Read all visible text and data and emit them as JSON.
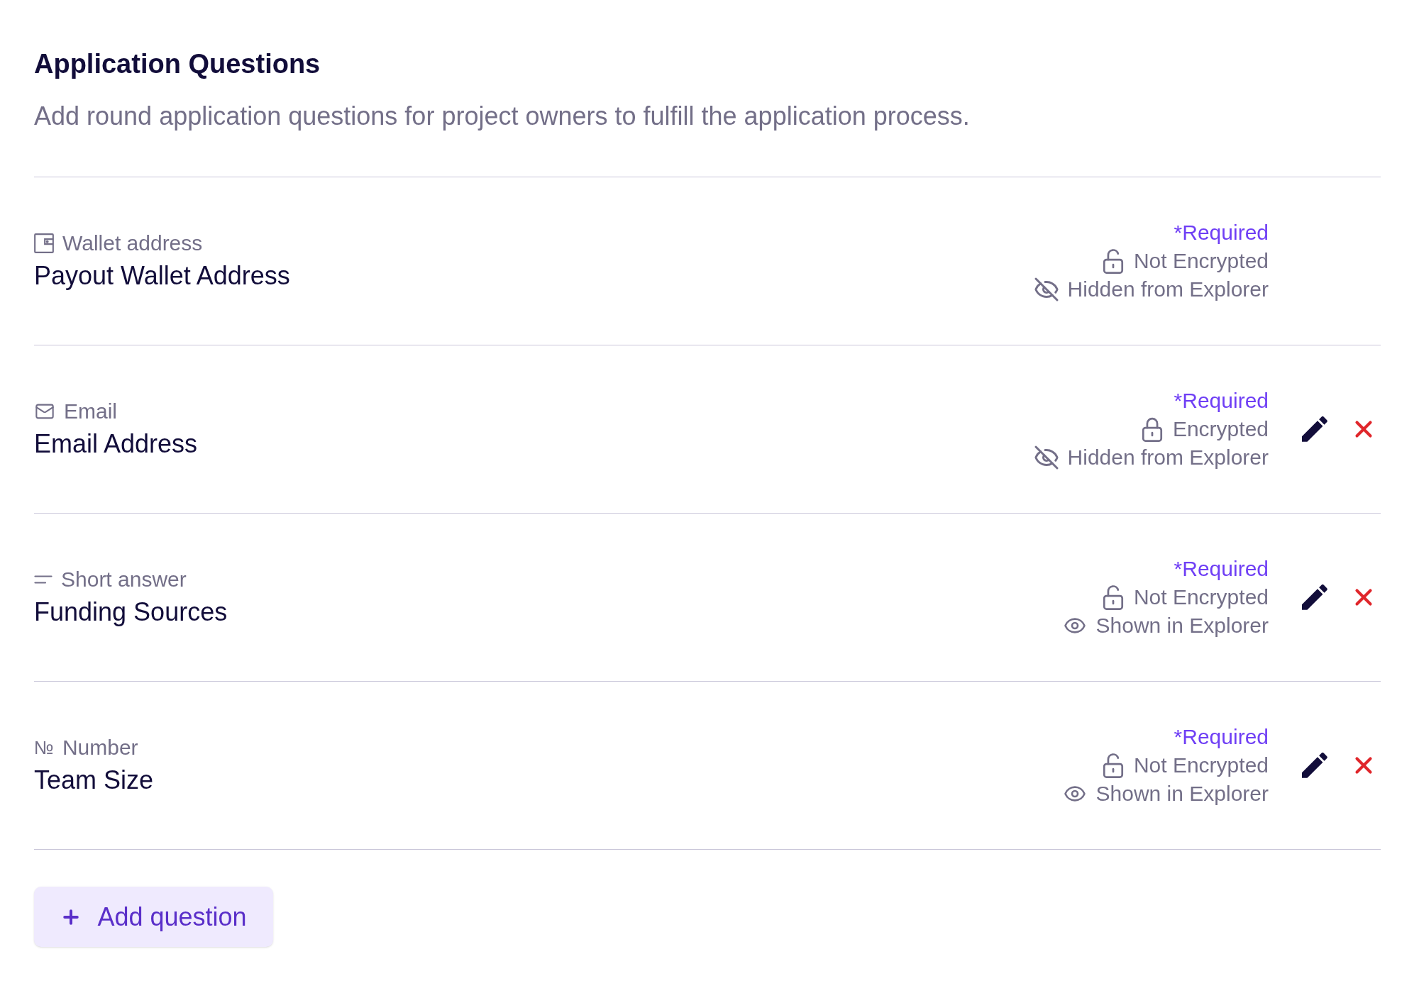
{
  "header": {
    "title": "Application Questions",
    "description": "Add round application questions for project owners to fulfill the application process."
  },
  "questions": [
    {
      "kind": "wallet",
      "type_label": "Wallet address",
      "title": "Payout Wallet Address",
      "required_label": "*Required",
      "encryption": {
        "encrypted": false,
        "label": "Not Encrypted"
      },
      "visibility": {
        "shown": false,
        "label": "Hidden from Explorer"
      },
      "editable": false
    },
    {
      "kind": "email",
      "type_label": "Email",
      "title": "Email Address",
      "required_label": "*Required",
      "encryption": {
        "encrypted": true,
        "label": "Encrypted"
      },
      "visibility": {
        "shown": false,
        "label": "Hidden from Explorer"
      },
      "editable": true
    },
    {
      "kind": "short_answer",
      "type_label": "Short answer",
      "title": "Funding Sources",
      "required_label": "*Required",
      "encryption": {
        "encrypted": false,
        "label": "Not Encrypted"
      },
      "visibility": {
        "shown": true,
        "label": "Shown in Explorer"
      },
      "editable": true
    },
    {
      "kind": "number",
      "symbol": "№",
      "type_label": "Number",
      "title": "Team Size",
      "required_label": "*Required",
      "encryption": {
        "encrypted": false,
        "label": "Not Encrypted"
      },
      "visibility": {
        "shown": true,
        "label": "Shown in Explorer"
      },
      "editable": true
    }
  ],
  "add_button": {
    "label": "Add question"
  }
}
